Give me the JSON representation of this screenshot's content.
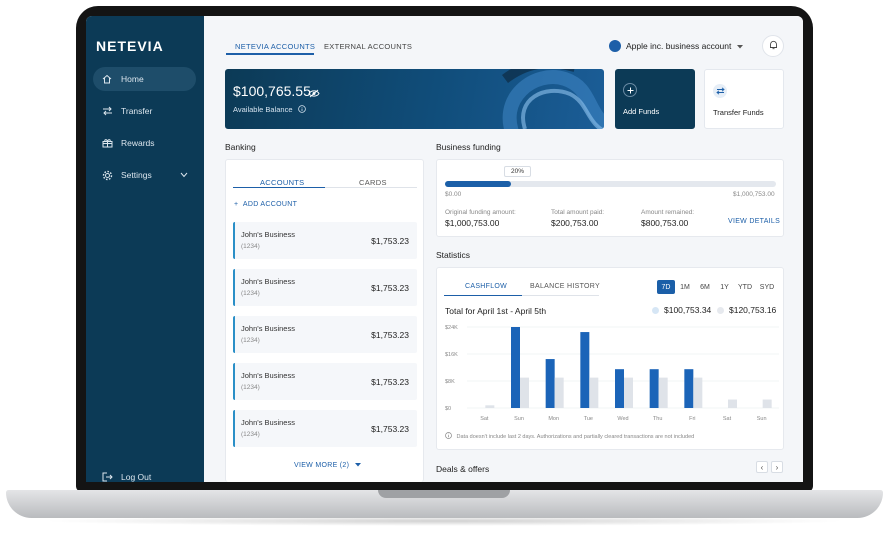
{
  "brand": {
    "logo": "NETEVIA"
  },
  "sidebar": {
    "items": [
      {
        "label": "Home",
        "icon": "home-icon",
        "active": true
      },
      {
        "label": "Transfer",
        "icon": "transfer-icon"
      },
      {
        "label": "Rewards",
        "icon": "rewards-icon"
      },
      {
        "label": "Settings",
        "icon": "gear-icon"
      }
    ],
    "logout": "Log Out"
  },
  "header": {
    "tabs": [
      "NETEVIA ACCOUNTS",
      "EXTERNAL ACCOUNTS"
    ],
    "account_selector": "Apple inc. business account"
  },
  "balance": {
    "amount": "$100,765.55",
    "label": "Available Balance"
  },
  "quick_actions": [
    {
      "label": "Add Funds",
      "icon": "plus-icon"
    },
    {
      "label": "Transfer Funds",
      "icon": "transfer-arrows-icon"
    }
  ],
  "banking": {
    "title": "Banking",
    "tabs": [
      "ACCOUNTS",
      "CARDS"
    ],
    "add_account": "ADD ACCOUNT",
    "accounts": [
      {
        "name": "John's Business",
        "number": "(1234)",
        "amount": "$1,753.23"
      },
      {
        "name": "John's Business",
        "number": "(1234)",
        "amount": "$1,753.23"
      },
      {
        "name": "John's Business",
        "number": "(1234)",
        "amount": "$1,753.23"
      },
      {
        "name": "John's Business",
        "number": "(1234)",
        "amount": "$1,753.23"
      },
      {
        "name": "John's Business",
        "number": "(1234)",
        "amount": "$1,753.23"
      }
    ],
    "view_more": "VIEW MORE (2)"
  },
  "funding": {
    "title": "Business funding",
    "progress_label": "20%",
    "progress": 0.2,
    "min_label": "$0.00",
    "max_label": "$1,000,753.00",
    "original_label": "Original funding amount:",
    "original_value": "$1,000,753.00",
    "paid_label": "Total amount paid:",
    "paid_value": "$200,753.00",
    "remained_label": "Amount remained:",
    "remained_value": "$800,753.00",
    "view_details": "VIEW DETAILS"
  },
  "statistics": {
    "title": "Statistics",
    "tabs": [
      "CASHFLOW",
      "BALANCE HISTORY"
    ],
    "ranges": [
      "7D",
      "1M",
      "6M",
      "1Y",
      "YTD",
      "SYD"
    ],
    "active_range": "7D",
    "total_label": "Total for April 1st - April 5th",
    "in_value": "$100,753.34",
    "out_value": "$120,753.16",
    "note": "Data doesn't include last 2 days. Authorizations and partially cleared transactions are not included"
  },
  "chart_data": {
    "type": "bar",
    "categories": [
      "Sat",
      "Sun",
      "Mon",
      "Tue",
      "Wed",
      "Thu",
      "Fri",
      "Sat",
      "Sun"
    ],
    "yticks": [
      "$0",
      "$8K",
      "$16K",
      "$24K"
    ],
    "ylim": [
      0,
      24000
    ],
    "series": [
      {
        "values": [
          0,
          24000,
          14500,
          22500,
          11500,
          11500,
          11500,
          0,
          0
        ],
        "color": "#1b64b8"
      },
      {
        "values": [
          800,
          9000,
          9000,
          9000,
          9000,
          9000,
          9000,
          2500,
          2500
        ],
        "color": "#dfe3e9"
      }
    ]
  },
  "offers": {
    "title": "Deals & offers"
  }
}
